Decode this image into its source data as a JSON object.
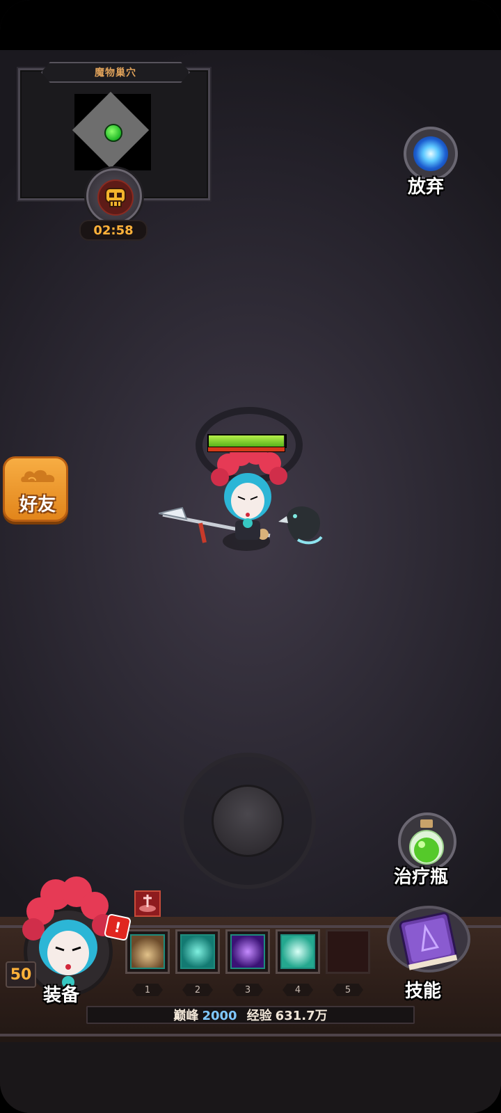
{
  "minimap": {
    "title": "魔物巢穴"
  },
  "timer": {
    "value": "02:58"
  },
  "actions": {
    "give_up": "放弃",
    "friends": "好友",
    "heal_potion": "治疗瓶",
    "equipment": "装备",
    "skills": "技能"
  },
  "player": {
    "level": "50",
    "hp_fraction": 0.98,
    "alert": "!"
  },
  "skill_slots": [
    {
      "num": "1",
      "icon": "earth-skill-icon",
      "color": "#c49a5a"
    },
    {
      "num": "2",
      "icon": "wolf-skill-icon",
      "color": "#2fb9a8"
    },
    {
      "num": "3",
      "icon": "shadow-skill-icon",
      "color": "#7a3ed1"
    },
    {
      "num": "4",
      "icon": "spirit-skill-icon",
      "color": "#49e0c4"
    },
    {
      "num": "5",
      "icon": "empty-slot",
      "color": "#2a1514"
    }
  ],
  "status": {
    "peak_label": "巅峰",
    "peak_value": "2000",
    "exp_label": "经验",
    "exp_value": "631.7万"
  }
}
